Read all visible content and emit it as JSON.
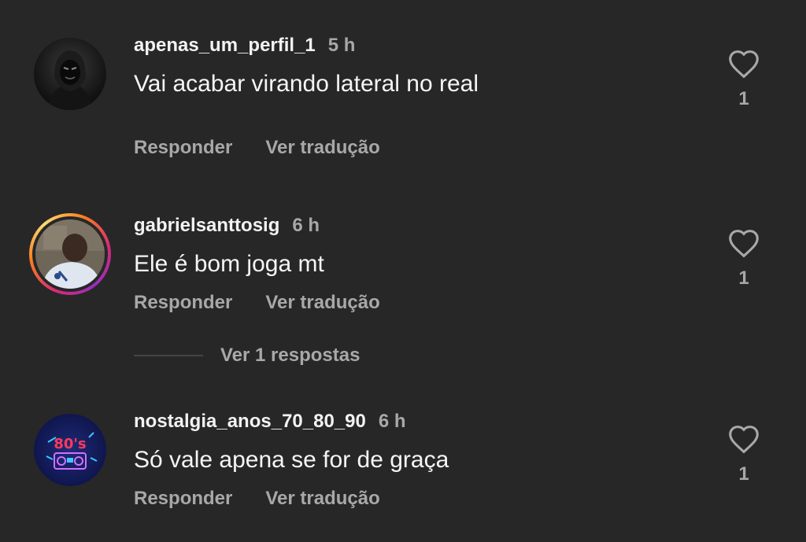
{
  "comments": [
    {
      "username": "apenas_um_perfil_1",
      "time": "5 h",
      "text": "Vai acabar virando lateral no real",
      "reply_label": "Responder",
      "translate_label": "Ver tradução",
      "likes": "1",
      "avatar_icon": "hooded-figure-avatar",
      "has_story_ring": false
    },
    {
      "username": "gabrielsanttosig",
      "time": "6 h",
      "text": "Ele é bom joga mt",
      "reply_label": "Responder",
      "translate_label": "Ver tradução",
      "likes": "1",
      "avatar_icon": "person-photo-avatar",
      "has_story_ring": true,
      "view_replies": "Ver 1 respostas"
    },
    {
      "username": "nostalgia_anos_70_80_90",
      "time": "6 h",
      "text": "Só vale apena se for de graça",
      "reply_label": "Responder",
      "translate_label": "Ver tradução",
      "likes": "1",
      "avatar_icon": "80s-boombox-avatar",
      "has_story_ring": false
    }
  ],
  "colors": {
    "background": "#272727",
    "primary_text": "#f5f5f5",
    "secondary_text": "#a8a8a8",
    "story_ring": [
      "#d62976",
      "#fa7e1e",
      "#feda75",
      "#962fbf"
    ]
  }
}
